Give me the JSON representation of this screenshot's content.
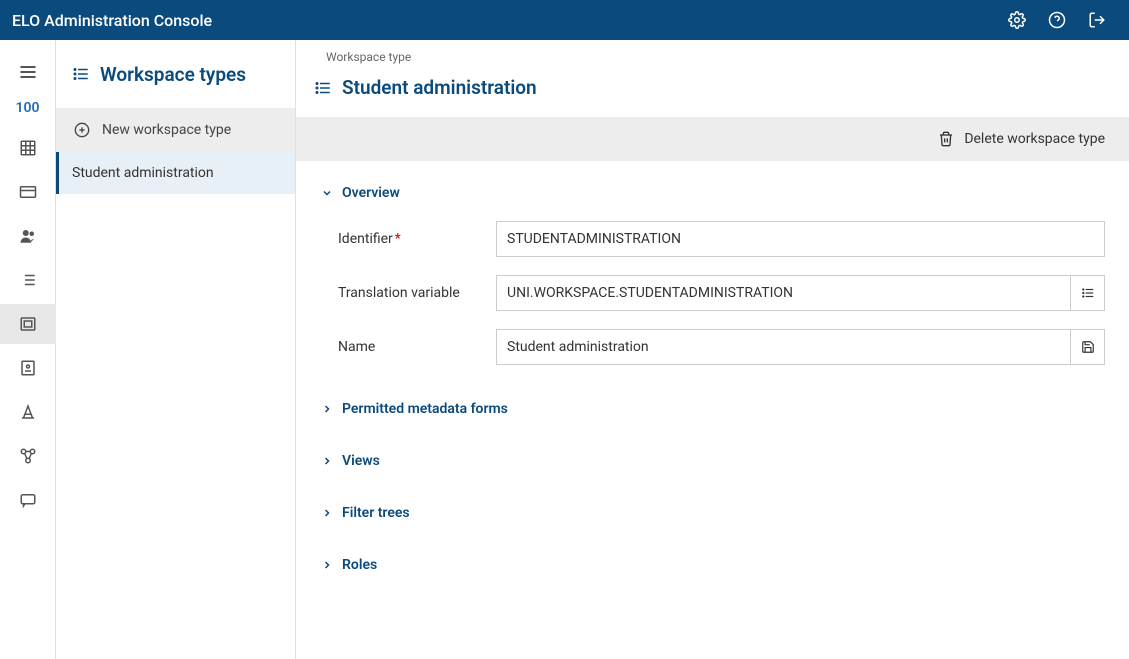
{
  "topbar": {
    "title": "ELO Administration Console"
  },
  "sidebar": {
    "badge": "100"
  },
  "listPanel": {
    "title": "Workspace types",
    "newLabel": "New workspace type",
    "items": [
      {
        "label": "Student administration"
      }
    ]
  },
  "content": {
    "breadcrumb": "Workspace type",
    "title": "Student administration",
    "deleteLabel": "Delete workspace type"
  },
  "sections": {
    "overview": "Overview",
    "permitted": "Permitted metadata forms",
    "views": "Views",
    "filterTrees": "Filter trees",
    "roles": "Roles"
  },
  "form": {
    "identifier": {
      "label": "Identifier",
      "value": "STUDENTADMINISTRATION"
    },
    "translation": {
      "label": "Translation variable",
      "value": "UNI.WORKSPACE.STUDENTADMINISTRATION"
    },
    "name": {
      "label": "Name",
      "value": "Student administration"
    }
  }
}
